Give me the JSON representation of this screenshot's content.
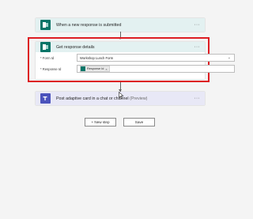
{
  "flow": {
    "trigger": {
      "title": "When a new response is submitted",
      "icon": "forms-icon",
      "more": "···"
    },
    "action1": {
      "title": "Get response details",
      "icon": "forms-icon",
      "more": "···",
      "form_id_label": "* Form Id",
      "form_id_value": "Workshop Lunch Form",
      "response_id_label": "* Response Id",
      "response_id_token": "Response Id",
      "token_remove": "×"
    },
    "action2": {
      "title": "Post adaptive card in a chat or channel",
      "suffix": "(Preview)",
      "icon": "teams-icon",
      "more": "···"
    }
  },
  "buttons": {
    "new_step": "+ New step",
    "save": "Save"
  },
  "colors": {
    "forms_green": "#077568",
    "teams_purple": "#4b53bc",
    "highlight_red": "#dd1c22"
  }
}
